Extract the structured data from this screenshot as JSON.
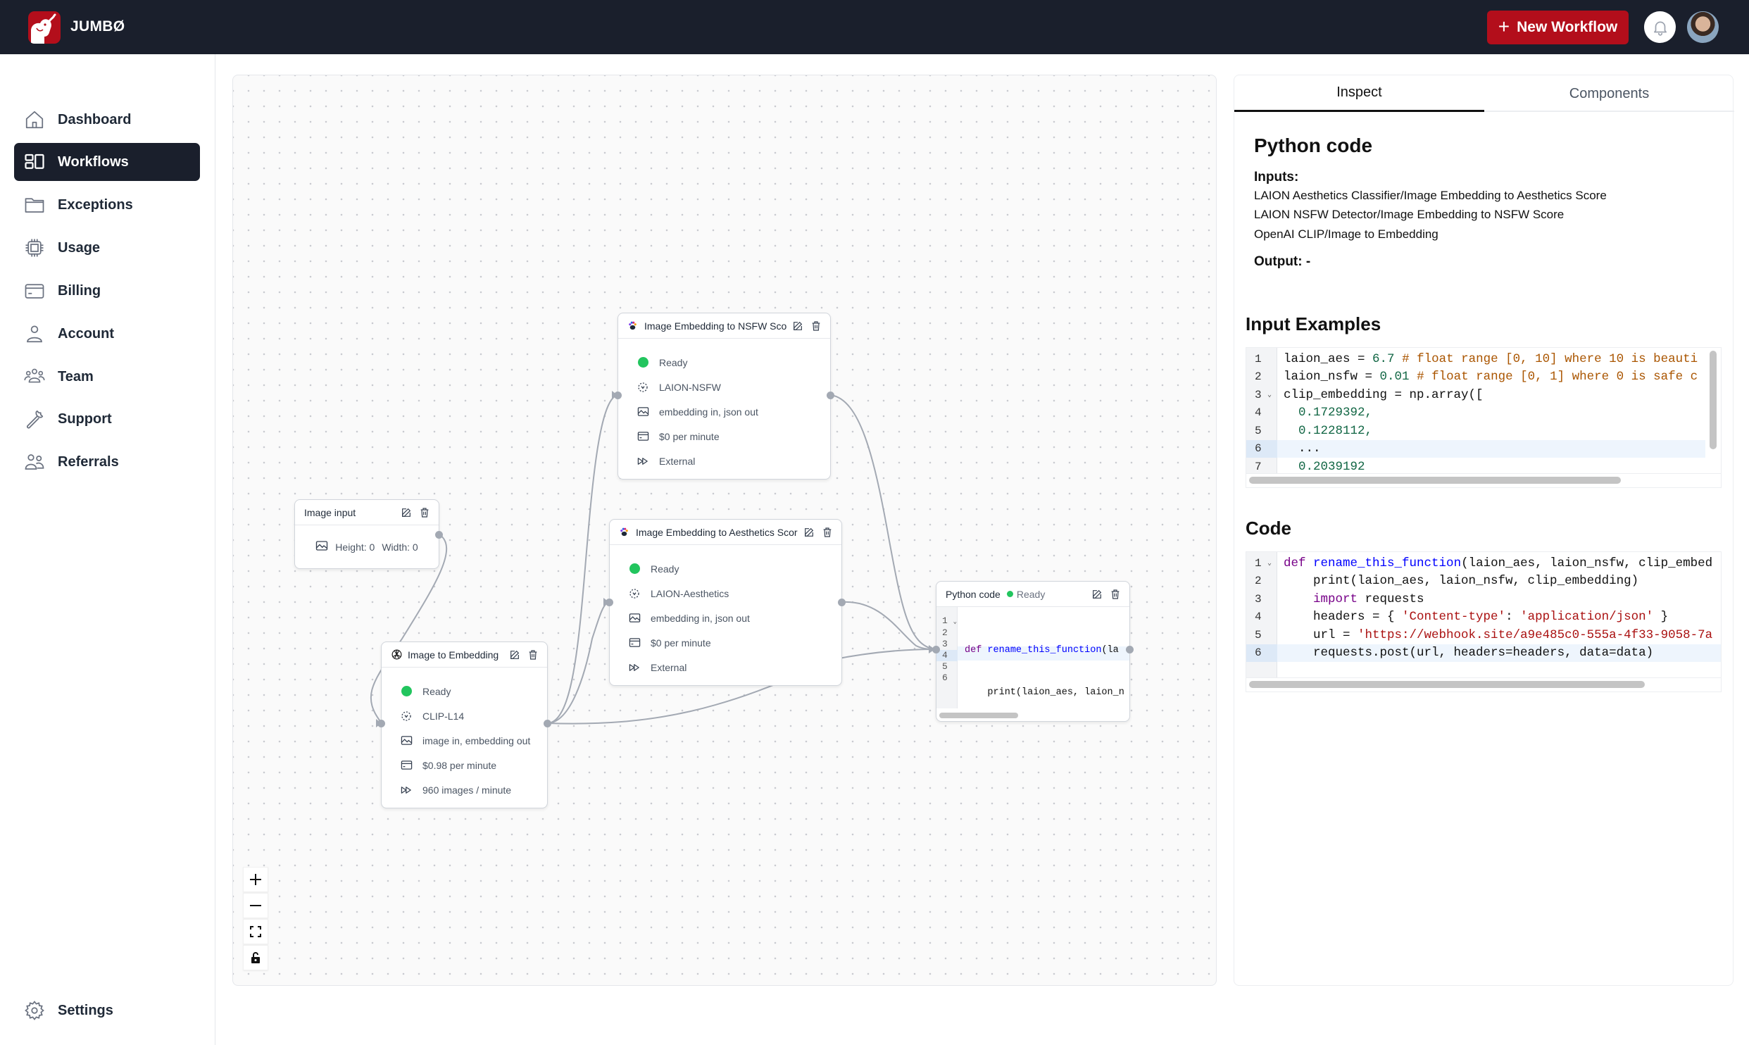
{
  "header": {
    "brand": "JUMBØ",
    "new_workflow_label": "New Workflow",
    "accent_color": "#b30e1b"
  },
  "sidebar": {
    "items": [
      {
        "label": "Dashboard",
        "icon": "home-icon",
        "active": false
      },
      {
        "label": "Workflows",
        "icon": "workflows-icon",
        "active": true
      },
      {
        "label": "Exceptions",
        "icon": "folder-icon",
        "active": false
      },
      {
        "label": "Usage",
        "icon": "chip-icon",
        "active": false
      },
      {
        "label": "Billing",
        "icon": "credit-card-icon",
        "active": false
      },
      {
        "label": "Account",
        "icon": "user-icon",
        "active": false
      },
      {
        "label": "Team",
        "icon": "team-icon",
        "active": false
      },
      {
        "label": "Support",
        "icon": "wrench-icon",
        "active": false
      },
      {
        "label": "Referrals",
        "icon": "users-icon",
        "active": false
      }
    ],
    "settings_label": "Settings"
  },
  "canvas": {
    "nodes": {
      "image_input": {
        "title": "Image input",
        "height_label": "Height: 0",
        "width_label": "Width: 0"
      },
      "image_to_embedding": {
        "title": "Image to Embedding",
        "status": "Ready",
        "model": "CLIP-L14",
        "io": "image in, embedding out",
        "price": "$0.98 per minute",
        "throughput": "960 images / minute"
      },
      "nsfw": {
        "title": "Image Embedding to NSFW Score",
        "status": "Ready",
        "model": "LAION-NSFW",
        "io": "embedding in, json out",
        "price": "$0 per minute",
        "throughput": "External"
      },
      "aesthetics": {
        "title": "Image Embedding to Aesthetics Score",
        "status": "Ready",
        "model": "LAION-Aesthetics",
        "io": "embedding in, json out",
        "price": "$0 per minute",
        "throughput": "External"
      },
      "python": {
        "title": "Python code",
        "status": "Ready",
        "lines": [
          "def rename_this_function(la",
          "    print(laion_aes, laion_n",
          "    import requests",
          "    headers = { 'Content-typ",
          "    url = 'https://webhook.s",
          "    requests.post(url, heade"
        ],
        "line_numbers": [
          "1",
          "2",
          "3",
          "4",
          "5",
          "6"
        ]
      }
    },
    "controls": [
      "zoom-in",
      "zoom-out",
      "fit-view",
      "lock"
    ]
  },
  "panel": {
    "tabs": [
      {
        "label": "Inspect",
        "active": true
      },
      {
        "label": "Components",
        "active": false
      }
    ],
    "title": "Python code",
    "inputs_label": "Inputs:",
    "inputs": [
      "LAION Aesthetics Classifier/Image Embedding to Aesthetics Score",
      "LAION NSFW Detector/Image Embedding to NSFW Score",
      "OpenAI CLIP/Image to Embedding"
    ],
    "output_label": "Output: -",
    "input_examples_title": "Input Examples",
    "input_examples": [
      {
        "n": "1",
        "code": "laion_aes = 6.7 # float range [0, 10] where 10 is beauti"
      },
      {
        "n": "2",
        "code": "laion_nsfw = 0.01 # float range [0, 1] where 0 is safe c"
      },
      {
        "n": "3",
        "code": "clip_embedding = np.array(["
      },
      {
        "n": "4",
        "code": "  0.1729392,"
      },
      {
        "n": "5",
        "code": "  0.1228112,"
      },
      {
        "n": "6",
        "code": "  ..."
      },
      {
        "n": "7",
        "code": "  0.2039192"
      }
    ],
    "code_title": "Code",
    "code": [
      {
        "n": "1",
        "code": "def rename_this_function(laion_aes, laion_nsfw, clip_embed"
      },
      {
        "n": "2",
        "code": "    print(laion_aes, laion_nsfw, clip_embedding)"
      },
      {
        "n": "3",
        "code": "    import requests"
      },
      {
        "n": "4",
        "code": "    headers = { 'Content-type': 'application/json' }"
      },
      {
        "n": "5",
        "code": "    url = 'https://webhook.site/a9e485c0-555a-4f33-9058-7a"
      },
      {
        "n": "6",
        "code": "    requests.post(url, headers=headers, data=data)"
      }
    ]
  }
}
